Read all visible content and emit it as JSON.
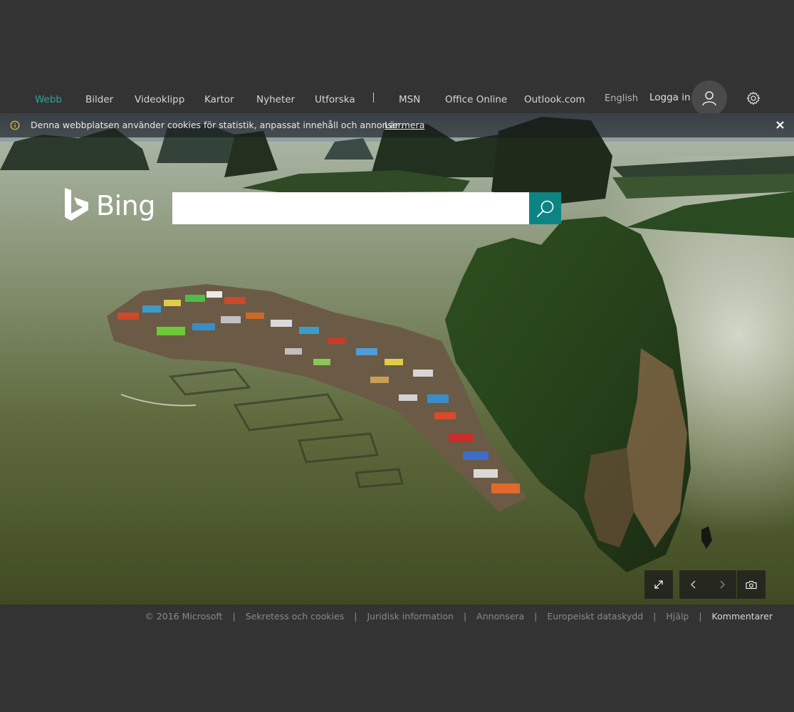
{
  "nav": {
    "items": [
      {
        "label": "Webb",
        "active": true
      },
      {
        "label": "Bilder"
      },
      {
        "label": "Videoklipp"
      },
      {
        "label": "Kartor"
      },
      {
        "label": "Nyheter"
      },
      {
        "label": "Utforska"
      },
      {
        "label": "MSN"
      },
      {
        "label": "Office Online"
      },
      {
        "label": "Outlook.com"
      }
    ],
    "language": "English",
    "signin": "Logga in",
    "avatar_icon": "user-icon",
    "settings_icon": "gear-icon",
    "accent_color": "#2aa7a0"
  },
  "cookie_banner": {
    "icon": "info-icon",
    "text": "Denna webbplatsen använder cookies för statistik, anpassat innehåll och annonser.",
    "link": "Lär mera",
    "close_icon": "close-icon"
  },
  "search": {
    "logo_text": "Bing",
    "value": "",
    "button_icon": "search-icon",
    "button_color": "#0c8484"
  },
  "image_controls": [
    {
      "icon": "expand-icon"
    },
    {
      "icon": "chevron-left-icon"
    },
    {
      "icon": "chevron-right-icon"
    },
    {
      "icon": "camera-icon"
    }
  ],
  "footer": {
    "items": [
      "© 2016 Microsoft",
      "Sekretess och cookies",
      "Juridisk information",
      "Annonsera",
      "Europeiskt dataskydd",
      "Hjälp",
      "Kommentarer"
    ]
  }
}
